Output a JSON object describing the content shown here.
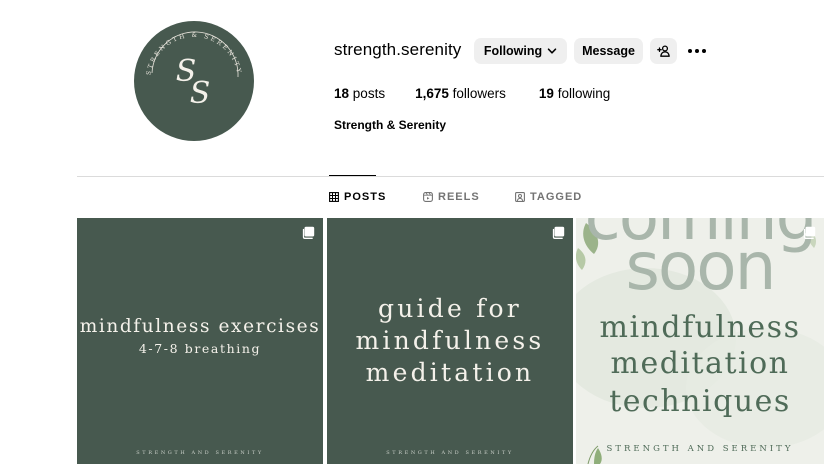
{
  "profile": {
    "username": "strength.serenity",
    "display_name": "Strength & Serenity",
    "avatar_monogram": "SS",
    "avatar_ring_text": "STRENGTH & SERENITY"
  },
  "actions": {
    "following_label": "Following",
    "message_label": "Message"
  },
  "stats": {
    "posts_count": "18",
    "posts_label": "posts",
    "followers_count": "1,675",
    "followers_label": "followers",
    "following_count": "19",
    "following_label": "following"
  },
  "tabs": [
    {
      "label": "POSTS",
      "icon": "grid-icon",
      "active": true
    },
    {
      "label": "REELS",
      "icon": "reels-icon",
      "active": false
    },
    {
      "label": "TAGGED",
      "icon": "tagged-icon",
      "active": false
    }
  ],
  "posts": [
    {
      "title": "mindfulness exercises",
      "subtitle": "4-7-8 breathing",
      "footer": "STRENGTH AND SERENITY",
      "multi": true
    },
    {
      "lines": [
        "guide for",
        "mindfulness",
        "meditation"
      ],
      "footer": "STRENGTH AND SERENITY",
      "multi": true
    },
    {
      "background_lines": [
        "coming",
        "soon"
      ],
      "lines": [
        "mindfulness",
        "meditation",
        "techniques"
      ],
      "footer": "STRENGTH AND SERENITY",
      "multi": true
    }
  ],
  "colors": {
    "brand_green": "#47594f",
    "text_green": "#4f6b58",
    "button_bg": "#efefef",
    "divider": "#dbdbdb",
    "muted": "#737373"
  }
}
